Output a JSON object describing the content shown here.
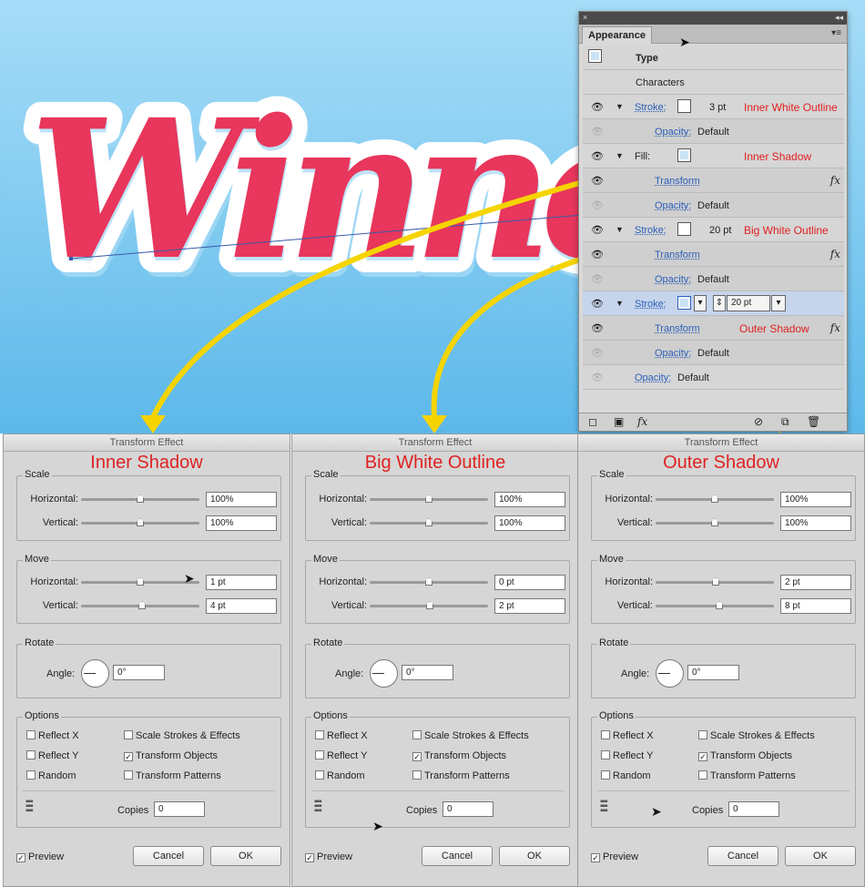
{
  "artwork": {
    "text": "Winne"
  },
  "appearance_panel": {
    "title": "Appearance",
    "rows": [
      {
        "kind": "type",
        "label": "Type"
      },
      {
        "kind": "plain",
        "label": "Characters"
      },
      {
        "kind": "stroke",
        "label": "Stroke:",
        "value": "3 pt",
        "note": "Inner White Outline"
      },
      {
        "kind": "opacity",
        "label": "Opacity:",
        "value": "Default"
      },
      {
        "kind": "fill",
        "label": "Fill:",
        "note": "Inner Shadow"
      },
      {
        "kind": "transform",
        "label": "Transform"
      },
      {
        "kind": "opacity",
        "label": "Opacity:",
        "value": "Default"
      },
      {
        "kind": "stroke",
        "label": "Stroke:",
        "value": "20 pt",
        "note": "Big White Outline"
      },
      {
        "kind": "transform",
        "label": "Transform"
      },
      {
        "kind": "opacity",
        "label": "Opacity:",
        "value": "Default"
      },
      {
        "kind": "stroke-edit",
        "label": "Stroke:",
        "value": "20 pt"
      },
      {
        "kind": "transform",
        "label": "Transform",
        "note": "Outer Shadow"
      },
      {
        "kind": "opacity",
        "label": "Opacity:",
        "value": "Default"
      },
      {
        "kind": "opacity-top",
        "label": "Opacity:",
        "value": "Default"
      }
    ]
  },
  "dialogs": [
    {
      "window_title": "Transform Effect",
      "annotation": "Inner Shadow",
      "scale": {
        "label": "Scale",
        "horizontal_label": "Horizontal:",
        "horizontal": "100%",
        "vertical_label": "Vertical:",
        "vertical": "100%"
      },
      "move": {
        "label": "Move",
        "horizontal_label": "Horizontal:",
        "horizontal": "1 pt",
        "vertical_label": "Vertical:",
        "vertical": "4 pt"
      },
      "rotate": {
        "label": "Rotate",
        "angle_label": "Angle:",
        "angle": "0°"
      },
      "options": {
        "label": "Options",
        "reflect_x": "Reflect X",
        "reflect_y": "Reflect Y",
        "random": "Random",
        "scale_strokes": "Scale Strokes & Effects",
        "transform_objects": "Transform Objects",
        "transform_patterns": "Transform Patterns",
        "copies_label": "Copies",
        "copies": "0"
      },
      "preview": "Preview",
      "cancel": "Cancel",
      "ok": "OK"
    },
    {
      "window_title": "Transform Effect",
      "annotation": "Big White Outline",
      "scale": {
        "label": "Scale",
        "horizontal_label": "Horizontal:",
        "horizontal": "100%",
        "vertical_label": "Vertical:",
        "vertical": "100%"
      },
      "move": {
        "label": "Move",
        "horizontal_label": "Horizontal:",
        "horizontal": "0 pt",
        "vertical_label": "Vertical:",
        "vertical": "2 pt"
      },
      "rotate": {
        "label": "Rotate",
        "angle_label": "Angle:",
        "angle": "0°"
      },
      "options": {
        "label": "Options",
        "reflect_x": "Reflect X",
        "reflect_y": "Reflect Y",
        "random": "Random",
        "scale_strokes": "Scale Strokes & Effects",
        "transform_objects": "Transform Objects",
        "transform_patterns": "Transform Patterns",
        "copies_label": "Copies",
        "copies": "0"
      },
      "preview": "Preview",
      "cancel": "Cancel",
      "ok": "OK"
    },
    {
      "window_title": "Transform Effect",
      "annotation": "Outer Shadow",
      "scale": {
        "label": "Scale",
        "horizontal_label": "Horizontal:",
        "horizontal": "100%",
        "vertical_label": "Vertical:",
        "vertical": "100%"
      },
      "move": {
        "label": "Move",
        "horizontal_label": "Horizontal:",
        "horizontal": "2 pt",
        "vertical_label": "Vertical:",
        "vertical": "8 pt"
      },
      "rotate": {
        "label": "Rotate",
        "angle_label": "Angle:",
        "angle": "0°"
      },
      "options": {
        "label": "Options",
        "reflect_x": "Reflect X",
        "reflect_y": "Reflect Y",
        "random": "Random",
        "scale_strokes": "Scale Strokes & Effects",
        "transform_objects": "Transform Objects",
        "transform_patterns": "Transform Patterns",
        "copies_label": "Copies",
        "copies": "0"
      },
      "preview": "Preview",
      "cancel": "Cancel",
      "ok": "OK"
    }
  ],
  "colors": {
    "artwork_fill": "#e8365c",
    "annotation_red": "#e02222",
    "arrow_yellow": "#f5d400",
    "link_blue": "#2a5fb8"
  },
  "icons": [
    "eye-icon",
    "fx-icon",
    "trash-icon",
    "new-item-icon",
    "clear-appearance-icon",
    "reference-point-icon"
  ]
}
